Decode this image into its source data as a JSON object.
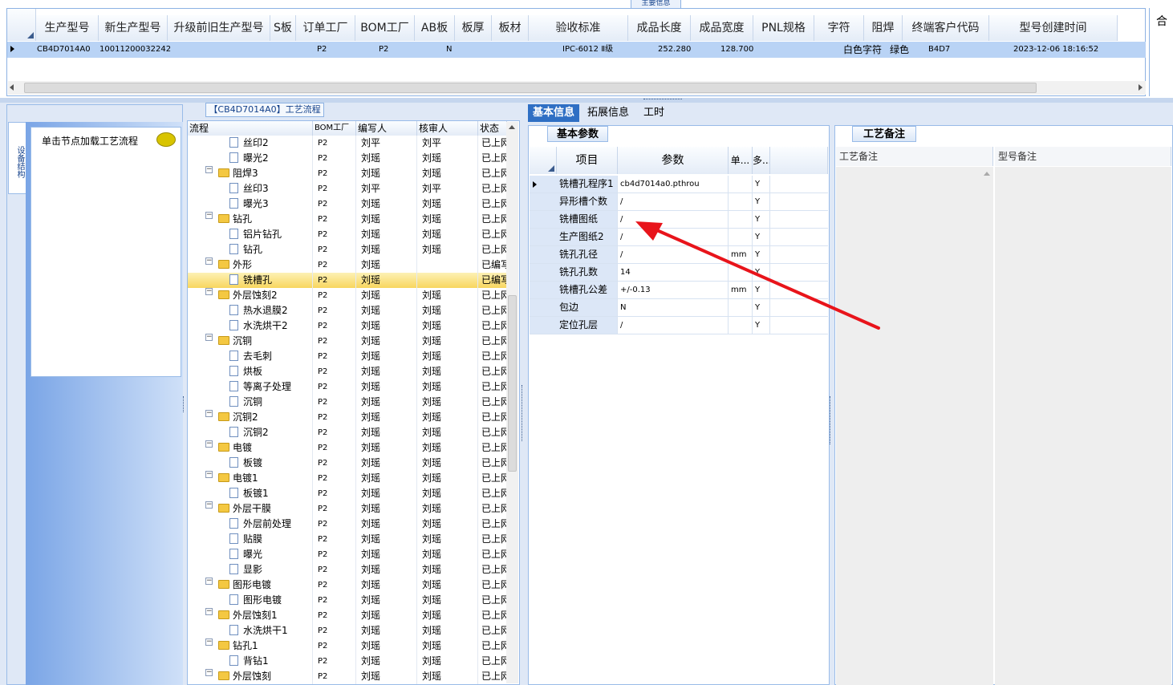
{
  "top": {
    "caption": "主要信息",
    "columns": [
      "生产型号",
      "新生产型号",
      "升级前旧生产型号",
      "S板",
      "订单工厂",
      "BOM工厂",
      "AB板",
      "板厚",
      "板材",
      "验收标准",
      "成品长度",
      "成品宽度",
      "PNL规格",
      "字符",
      "阻焊",
      "终端客户代码",
      "型号创建时间"
    ],
    "row": {
      "model": "CB4D7014A0",
      "new_model": "10011200032242",
      "order_factory": "P2",
      "bom_factory": "P2",
      "ab": "N",
      "standard": "IPC-6012 Ⅱ级",
      "length": "252.280",
      "width": "128.700",
      "char": "白色字符",
      "solder": "绿色",
      "customer": "B4D7",
      "created": "2023-12-06 18:16:52"
    },
    "right_label": "合"
  },
  "nav": {
    "tab_label": "设备结构",
    "hint": "单击节点加载工艺流程"
  },
  "tree": {
    "caption": "【CB4D7014A0】工艺流程",
    "headers": [
      "流程",
      "BOM工厂",
      "编写人",
      "核审人",
      "状态"
    ],
    "rows": [
      {
        "level": 2,
        "name": "丝印2",
        "bom": "P2",
        "writer": "刘平",
        "checker": "刘平",
        "status": "已上网"
      },
      {
        "level": 2,
        "name": "曝光2",
        "bom": "P2",
        "writer": "刘瑶",
        "checker": "刘瑶",
        "status": "已上网"
      },
      {
        "level": 1,
        "name": "阻焊3",
        "bom": "P2",
        "writer": "刘瑶",
        "checker": "刘瑶",
        "status": "已上网"
      },
      {
        "level": 2,
        "name": "丝印3",
        "bom": "P2",
        "writer": "刘平",
        "checker": "刘平",
        "status": "已上网"
      },
      {
        "level": 2,
        "name": "曝光3",
        "bom": "P2",
        "writer": "刘瑶",
        "checker": "刘瑶",
        "status": "已上网"
      },
      {
        "level": 1,
        "name": "钻孔",
        "bom": "P2",
        "writer": "刘瑶",
        "checker": "刘瑶",
        "status": "已上网"
      },
      {
        "level": 2,
        "name": "铝片钻孔",
        "bom": "P2",
        "writer": "刘瑶",
        "checker": "刘瑶",
        "status": "已上网"
      },
      {
        "level": 2,
        "name": "钻孔",
        "bom": "P2",
        "writer": "刘瑶",
        "checker": "刘瑶",
        "status": "已上网"
      },
      {
        "level": 1,
        "name": "外形",
        "bom": "P2",
        "writer": "刘瑶",
        "checker": "",
        "status": "已编写"
      },
      {
        "level": 2,
        "name": "铣槽孔",
        "bom": "P2",
        "writer": "刘瑶",
        "checker": "",
        "status": "已编写",
        "selected": true
      },
      {
        "level": 1,
        "name": "外层蚀刻2",
        "bom": "P2",
        "writer": "刘瑶",
        "checker": "刘瑶",
        "status": "已上网"
      },
      {
        "level": 2,
        "name": "热水退膜2",
        "bom": "P2",
        "writer": "刘瑶",
        "checker": "刘瑶",
        "status": "已上网"
      },
      {
        "level": 2,
        "name": "水洗烘干2",
        "bom": "P2",
        "writer": "刘瑶",
        "checker": "刘瑶",
        "status": "已上网"
      },
      {
        "level": 1,
        "name": "沉铜",
        "bom": "P2",
        "writer": "刘瑶",
        "checker": "刘瑶",
        "status": "已上网"
      },
      {
        "level": 2,
        "name": "去毛刺",
        "bom": "P2",
        "writer": "刘瑶",
        "checker": "刘瑶",
        "status": "已上网"
      },
      {
        "level": 2,
        "name": "烘板",
        "bom": "P2",
        "writer": "刘瑶",
        "checker": "刘瑶",
        "status": "已上网"
      },
      {
        "level": 2,
        "name": "等离子处理",
        "bom": "P2",
        "writer": "刘瑶",
        "checker": "刘瑶",
        "status": "已上网"
      },
      {
        "level": 2,
        "name": "沉铜",
        "bom": "P2",
        "writer": "刘瑶",
        "checker": "刘瑶",
        "status": "已上网"
      },
      {
        "level": 1,
        "name": "沉铜2",
        "bom": "P2",
        "writer": "刘瑶",
        "checker": "刘瑶",
        "status": "已上网"
      },
      {
        "level": 2,
        "name": "沉铜2",
        "bom": "P2",
        "writer": "刘瑶",
        "checker": "刘瑶",
        "status": "已上网"
      },
      {
        "level": 1,
        "name": "电镀",
        "bom": "P2",
        "writer": "刘瑶",
        "checker": "刘瑶",
        "status": "已上网"
      },
      {
        "level": 2,
        "name": "板镀",
        "bom": "P2",
        "writer": "刘瑶",
        "checker": "刘瑶",
        "status": "已上网"
      },
      {
        "level": 1,
        "name": "电镀1",
        "bom": "P2",
        "writer": "刘瑶",
        "checker": "刘瑶",
        "status": "已上网"
      },
      {
        "level": 2,
        "name": "板镀1",
        "bom": "P2",
        "writer": "刘瑶",
        "checker": "刘瑶",
        "status": "已上网"
      },
      {
        "level": 1,
        "name": "外层干膜",
        "bom": "P2",
        "writer": "刘瑶",
        "checker": "刘瑶",
        "status": "已上网"
      },
      {
        "level": 2,
        "name": "外层前处理",
        "bom": "P2",
        "writer": "刘瑶",
        "checker": "刘瑶",
        "status": "已上网"
      },
      {
        "level": 2,
        "name": "贴膜",
        "bom": "P2",
        "writer": "刘瑶",
        "checker": "刘瑶",
        "status": "已上网"
      },
      {
        "level": 2,
        "name": "曝光",
        "bom": "P2",
        "writer": "刘瑶",
        "checker": "刘瑶",
        "status": "已上网"
      },
      {
        "level": 2,
        "name": "显影",
        "bom": "P2",
        "writer": "刘瑶",
        "checker": "刘瑶",
        "status": "已上网"
      },
      {
        "level": 1,
        "name": "图形电镀",
        "bom": "P2",
        "writer": "刘瑶",
        "checker": "刘瑶",
        "status": "已上网"
      },
      {
        "level": 2,
        "name": "图形电镀",
        "bom": "P2",
        "writer": "刘瑶",
        "checker": "刘瑶",
        "status": "已上网"
      },
      {
        "level": 1,
        "name": "外层蚀刻1",
        "bom": "P2",
        "writer": "刘瑶",
        "checker": "刘瑶",
        "status": "已上网"
      },
      {
        "level": 2,
        "name": "水洗烘干1",
        "bom": "P2",
        "writer": "刘瑶",
        "checker": "刘瑶",
        "status": "已上网"
      },
      {
        "level": 1,
        "name": "钻孔1",
        "bom": "P2",
        "writer": "刘瑶",
        "checker": "刘瑶",
        "status": "已上网"
      },
      {
        "level": 2,
        "name": "背钻1",
        "bom": "P2",
        "writer": "刘瑶",
        "checker": "刘瑶",
        "status": "已上网"
      },
      {
        "level": 1,
        "name": "外层蚀刻",
        "bom": "P2",
        "writer": "刘瑶",
        "checker": "刘瑶",
        "status": "已上网"
      }
    ]
  },
  "right": {
    "tabs": [
      "基本信息",
      "拓展信息",
      "工时"
    ],
    "basic_caption": "基本参数",
    "param_headers": [
      "项目",
      "参数",
      "单...",
      "多..."
    ],
    "params": [
      {
        "name": "铣槽孔程序1",
        "value": "cb4d7014a0.pthrou",
        "unit": "",
        "flag": "Y"
      },
      {
        "name": "异形槽个数",
        "value": "/",
        "unit": "",
        "flag": "Y"
      },
      {
        "name": "铣槽图纸",
        "value": "/",
        "unit": "",
        "flag": "Y"
      },
      {
        "name": "生产图纸2",
        "value": "/",
        "unit": "",
        "flag": "Y"
      },
      {
        "name": "铣孔孔径",
        "value": "/",
        "unit": "mm",
        "flag": "Y"
      },
      {
        "name": "铣孔孔数",
        "value": "14",
        "unit": "",
        "flag": "Y"
      },
      {
        "name": "铣槽孔公差",
        "value": "+/-0.13",
        "unit": "mm",
        "flag": "Y"
      },
      {
        "name": "包边",
        "value": "N",
        "unit": "",
        "flag": "Y"
      },
      {
        "name": "定位孔层",
        "value": "/",
        "unit": "",
        "flag": "Y"
      }
    ],
    "notes_caption": "工艺备注",
    "notes_headers": [
      "工艺备注",
      "型号备注"
    ]
  },
  "colors": {
    "accent": "#2f6fc4",
    "selected_row": "#b9d3f5",
    "arrow": "#e8141b"
  }
}
